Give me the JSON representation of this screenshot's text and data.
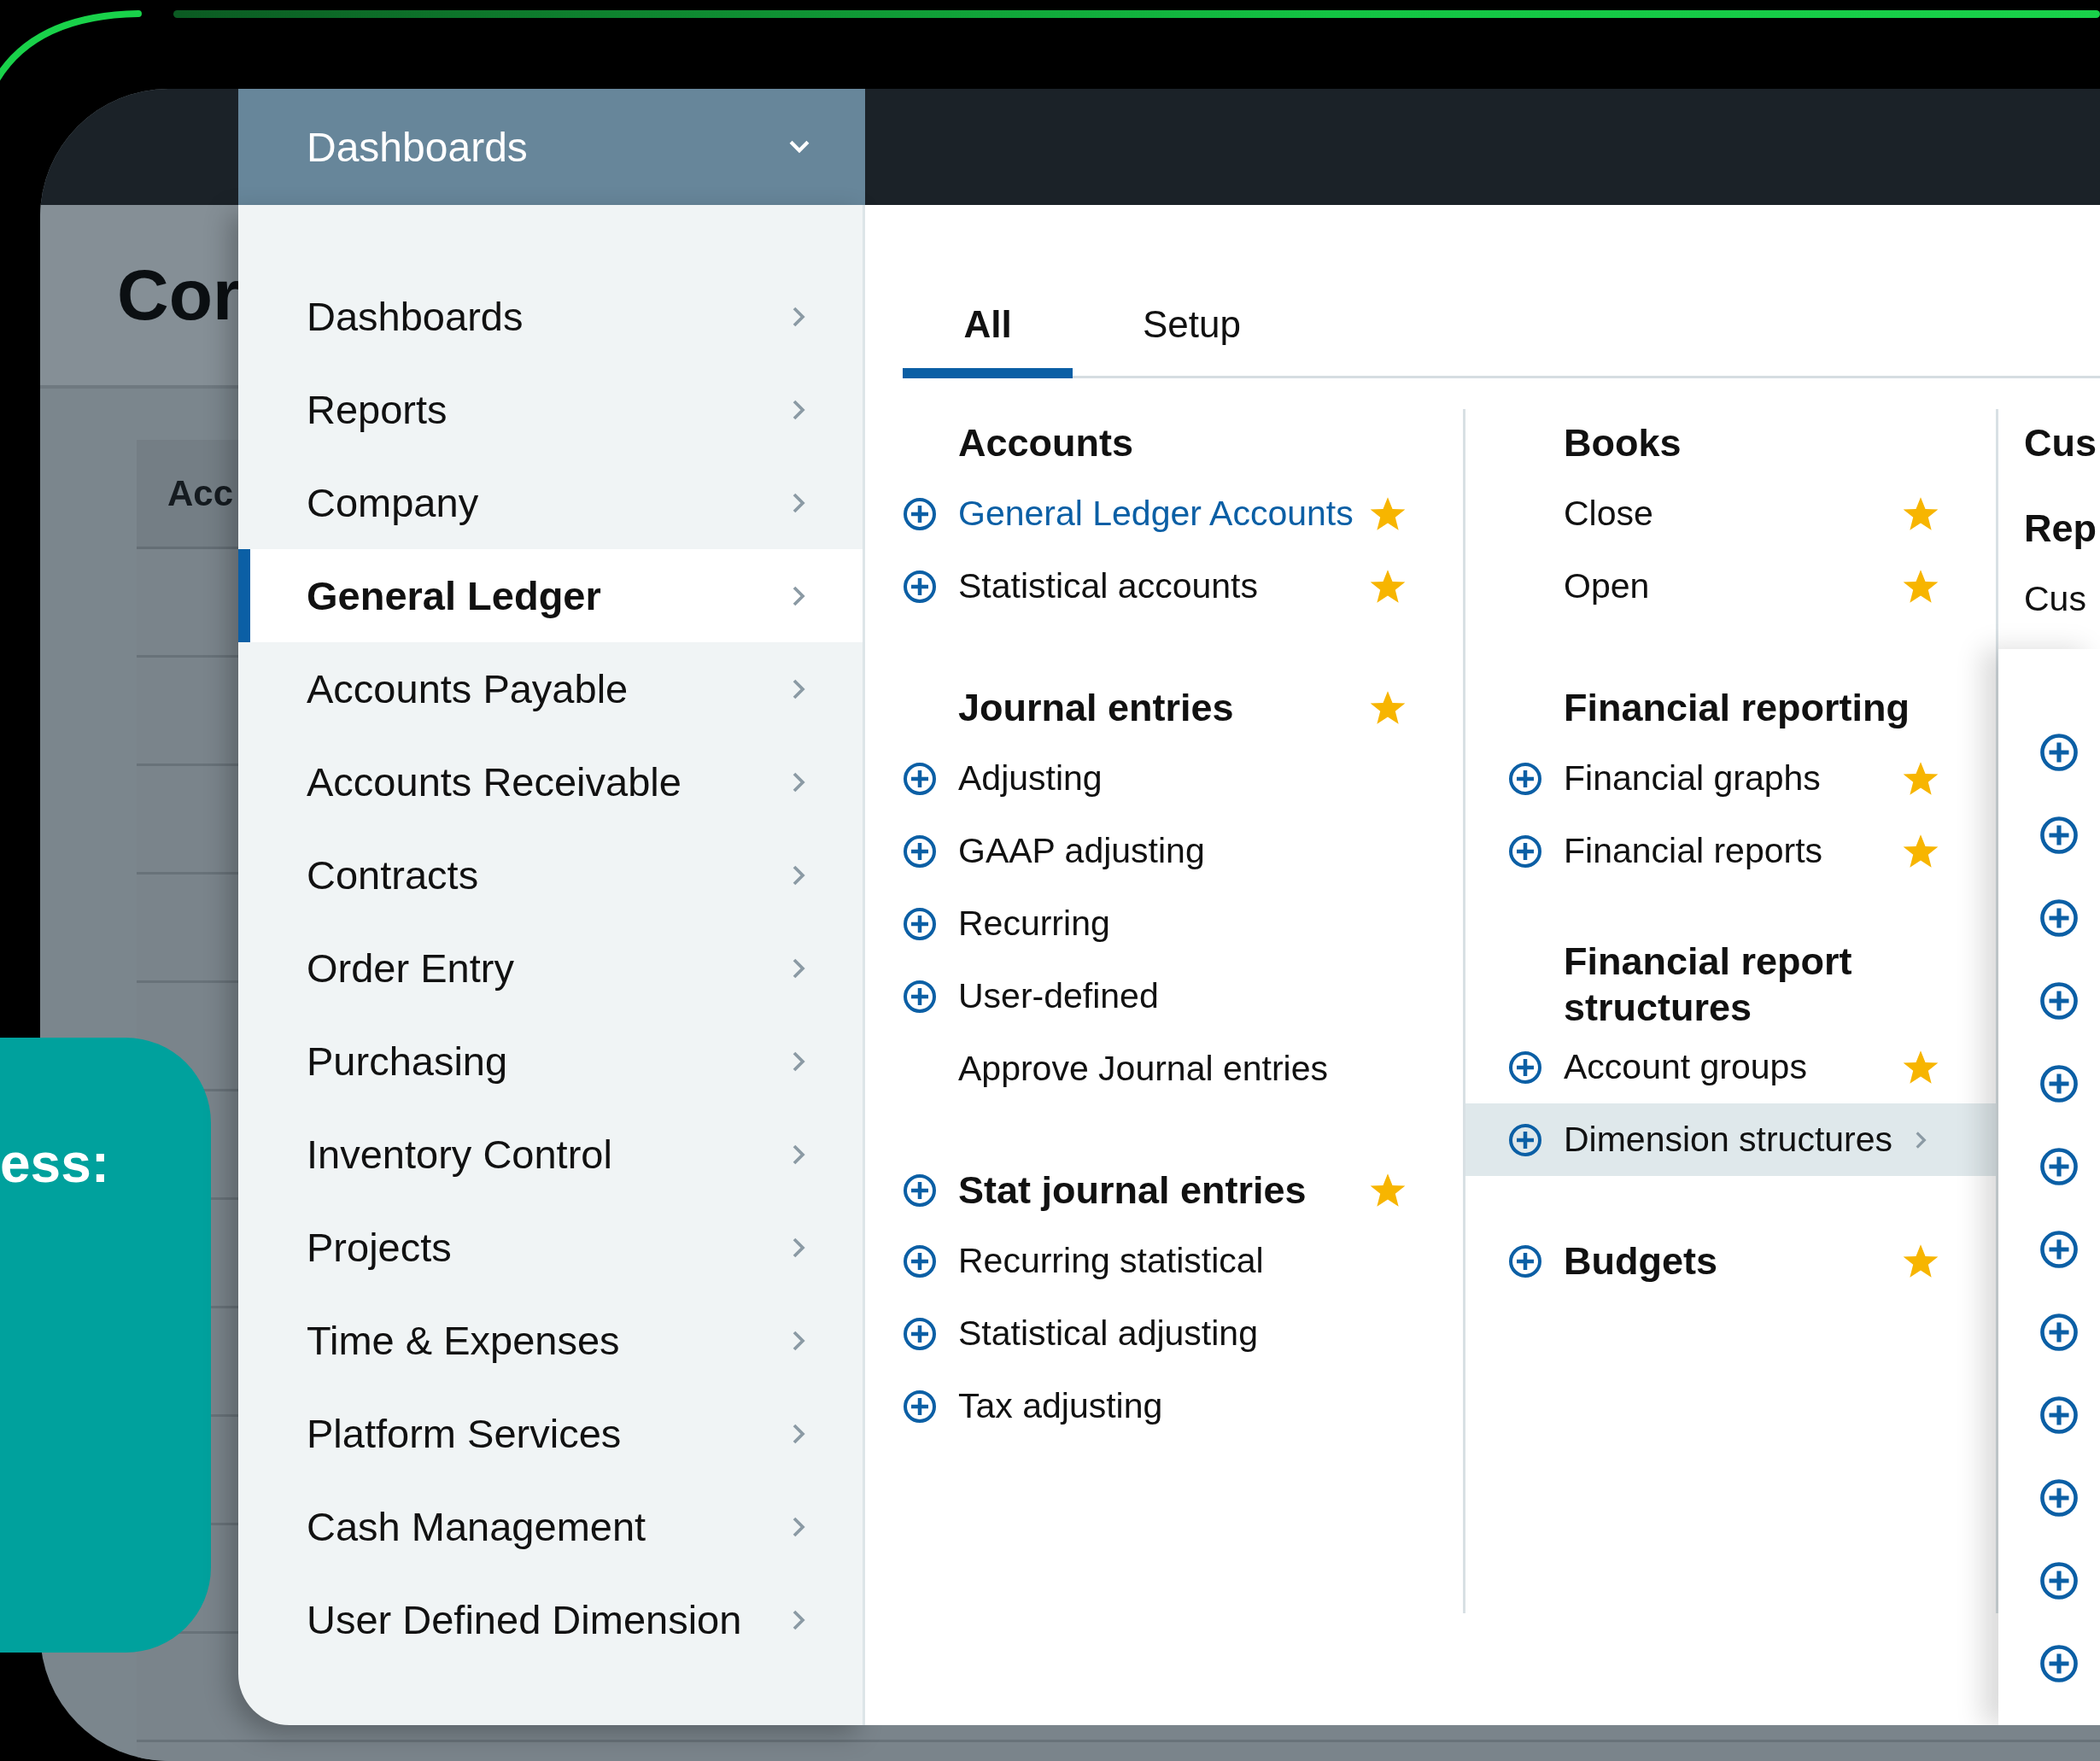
{
  "background": {
    "page_title": "Cor",
    "table_header": "Acc"
  },
  "callout": {
    "text": "ess:"
  },
  "menu": {
    "dropdown": {
      "label": "Dashboards"
    },
    "nav": [
      {
        "label": "Dashboards",
        "selected": false
      },
      {
        "label": "Reports",
        "selected": false
      },
      {
        "label": "Company",
        "selected": false
      },
      {
        "label": "General Ledger",
        "selected": true
      },
      {
        "label": "Accounts Payable",
        "selected": false
      },
      {
        "label": "Accounts Receivable",
        "selected": false
      },
      {
        "label": "Contracts",
        "selected": false
      },
      {
        "label": "Order Entry",
        "selected": false
      },
      {
        "label": "Purchasing",
        "selected": false
      },
      {
        "label": "Inventory Control",
        "selected": false
      },
      {
        "label": "Projects",
        "selected": false
      },
      {
        "label": "Time & Expenses",
        "selected": false
      },
      {
        "label": "Platform Services",
        "selected": false
      },
      {
        "label": "Cash Management",
        "selected": false
      },
      {
        "label": "User Defined Dimension",
        "selected": false
      }
    ],
    "tabs": [
      {
        "label": "All",
        "selected": true
      },
      {
        "label": "Setup",
        "selected": false
      }
    ],
    "columns": [
      {
        "rows": [
          {
            "kind": "heading",
            "text": "Accounts",
            "add_icon": false,
            "favorite": false,
            "link": false,
            "selected": false,
            "has_submenu": false
          },
          {
            "kind": "item",
            "text": "General Ledger Accounts",
            "add_icon": true,
            "favorite": true,
            "link": true,
            "selected": false,
            "has_submenu": false
          },
          {
            "kind": "item",
            "text": "Statistical accounts",
            "add_icon": true,
            "favorite": true,
            "link": false,
            "selected": false,
            "has_submenu": false
          },
          {
            "kind": "heading",
            "text": "Journal entries",
            "add_icon": false,
            "favorite": true,
            "link": false,
            "selected": false,
            "has_submenu": false
          },
          {
            "kind": "item",
            "text": "Adjusting",
            "add_icon": true,
            "favorite": false,
            "link": false,
            "selected": false,
            "has_submenu": false
          },
          {
            "kind": "item",
            "text": "GAAP adjusting",
            "add_icon": true,
            "favorite": false,
            "link": false,
            "selected": false,
            "has_submenu": false
          },
          {
            "kind": "item",
            "text": "Recurring",
            "add_icon": true,
            "favorite": false,
            "link": false,
            "selected": false,
            "has_submenu": false
          },
          {
            "kind": "item",
            "text": "User-defined",
            "add_icon": true,
            "favorite": false,
            "link": false,
            "selected": false,
            "has_submenu": false
          },
          {
            "kind": "item",
            "text": "Approve Journal entries",
            "add_icon": false,
            "favorite": false,
            "link": false,
            "selected": false,
            "has_submenu": false
          },
          {
            "kind": "heading",
            "text": "Stat journal entries",
            "add_icon": true,
            "favorite": true,
            "link": false,
            "selected": false,
            "has_submenu": false
          },
          {
            "kind": "item",
            "text": "Recurring statistical",
            "add_icon": true,
            "favorite": false,
            "link": false,
            "selected": false,
            "has_submenu": false
          },
          {
            "kind": "item",
            "text": "Statistical adjusting",
            "add_icon": true,
            "favorite": false,
            "link": false,
            "selected": false,
            "has_submenu": false
          },
          {
            "kind": "item",
            "text": "Tax adjusting",
            "add_icon": true,
            "favorite": false,
            "link": false,
            "selected": false,
            "has_submenu": false
          }
        ]
      },
      {
        "rows": [
          {
            "kind": "heading",
            "text": "Books",
            "add_icon": false,
            "favorite": false,
            "link": false,
            "selected": false,
            "has_submenu": false
          },
          {
            "kind": "item",
            "text": "Close",
            "add_icon": false,
            "favorite": true,
            "link": false,
            "selected": false,
            "has_submenu": false
          },
          {
            "kind": "item",
            "text": "Open",
            "add_icon": false,
            "favorite": true,
            "link": false,
            "selected": false,
            "has_submenu": false
          },
          {
            "kind": "heading",
            "text": "Financial reporting",
            "add_icon": false,
            "favorite": false,
            "link": false,
            "selected": false,
            "has_submenu": false
          },
          {
            "kind": "item",
            "text": "Financial graphs",
            "add_icon": true,
            "favorite": true,
            "link": false,
            "selected": false,
            "has_submenu": false
          },
          {
            "kind": "item",
            "text": "Financial reports",
            "add_icon": true,
            "favorite": true,
            "link": false,
            "selected": false,
            "has_submenu": false
          },
          {
            "kind": "heading",
            "text": "Financial report structures",
            "add_icon": false,
            "favorite": false,
            "link": false,
            "selected": false,
            "has_submenu": false
          },
          {
            "kind": "item",
            "text": "Account groups",
            "add_icon": true,
            "favorite": true,
            "link": false,
            "selected": false,
            "has_submenu": false
          },
          {
            "kind": "item",
            "text": "Dimension structures",
            "add_icon": true,
            "favorite": false,
            "link": false,
            "selected": true,
            "has_submenu": true
          },
          {
            "kind": "heading",
            "text": "Budgets",
            "add_icon": true,
            "favorite": true,
            "link": false,
            "selected": false,
            "has_submenu": false
          }
        ]
      },
      {
        "rows": [
          {
            "kind": "heading",
            "text": "Cus",
            "link": false,
            "selected": false
          },
          {
            "kind": "heading",
            "text": "Rep",
            "link": false,
            "selected": false
          },
          {
            "kind": "item",
            "text": "Cus",
            "link": false,
            "selected": false
          }
        ]
      }
    ],
    "submenu": {
      "items": [
        {
          "add_icon": true
        },
        {
          "add_icon": true
        },
        {
          "add_icon": true
        },
        {
          "add_icon": true
        },
        {
          "add_icon": true
        },
        {
          "add_icon": true
        },
        {
          "add_icon": true
        },
        {
          "add_icon": true
        },
        {
          "add_icon": true
        },
        {
          "add_icon": true
        },
        {
          "add_icon": true
        },
        {
          "add_icon": true
        }
      ]
    }
  }
}
